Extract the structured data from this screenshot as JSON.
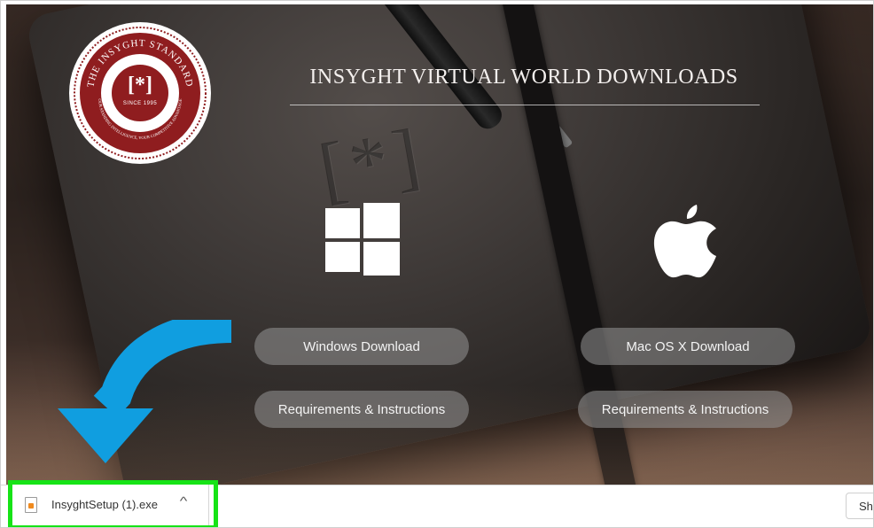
{
  "page": {
    "title": "INSYGHT VIRTUAL WORLD DOWNLOADS"
  },
  "logo": {
    "ring_text": "THE INSYGHT STANDARD",
    "lower_ring_text": "OUR STANDING INTELLIGENCE, YOUR COMPETITIVE ADVANTAGE",
    "mark": "[*]",
    "since": "SINCE 1995"
  },
  "platforms": {
    "windows": {
      "icon": "windows-logo-icon",
      "download_label": "Windows Download",
      "requirements_label": "Requirements & Instructions"
    },
    "mac": {
      "icon": "apple-logo-icon",
      "download_label": "Mac OS X Download",
      "requirements_label": "Requirements & Instructions"
    }
  },
  "annotation": {
    "arrow_color": "#109ee0",
    "highlight_color": "#16e316"
  },
  "download_bar": {
    "file_name": "InsyghtSetup (1).exe",
    "file_icon": "exe-file-icon",
    "chevron_icon": "chevron-up-icon",
    "show_all_label": "Sho"
  }
}
